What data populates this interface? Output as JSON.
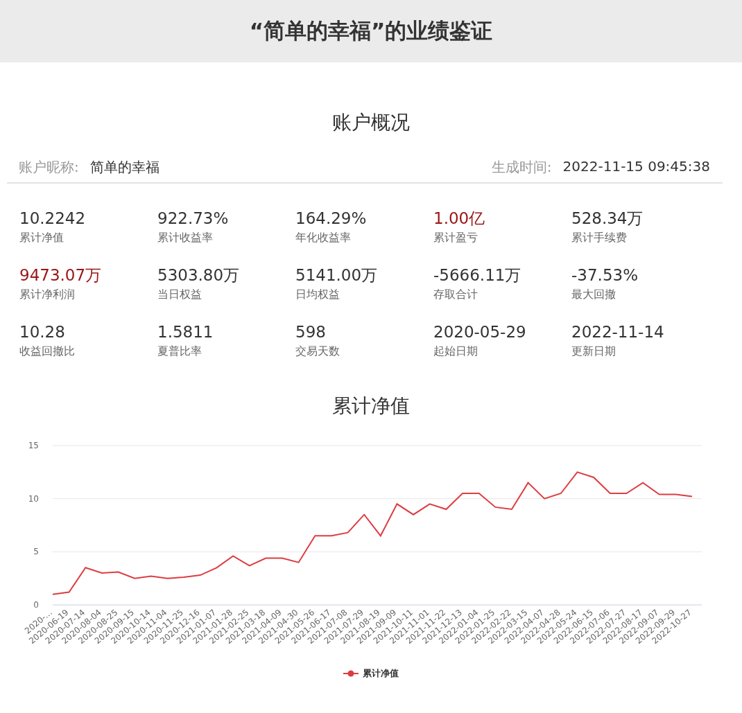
{
  "header": {
    "title": "“简单的幸福”的业绩鉴证"
  },
  "overview": {
    "heading": "账户概况",
    "nickname_label": "账户昵称:",
    "nickname": "简单的幸福",
    "generated_label": "生成时间:",
    "generated": "2022-11-15 09:45:38"
  },
  "stats": [
    {
      "value": "10.2242",
      "label": "累计净值",
      "highlight": false
    },
    {
      "value": "922.73%",
      "label": "累计收益率",
      "highlight": false
    },
    {
      "value": "164.29%",
      "label": "年化收益率",
      "highlight": false
    },
    {
      "value": "1.00亿",
      "label": "累计盈亏",
      "highlight": true
    },
    {
      "value": "528.34万",
      "label": "累计手续费",
      "highlight": false
    },
    {
      "value": "9473.07万",
      "label": "累计净利润",
      "highlight": true
    },
    {
      "value": "5303.80万",
      "label": "当日权益",
      "highlight": false
    },
    {
      "value": "5141.00万",
      "label": "日均权益",
      "highlight": false
    },
    {
      "value": "-5666.11万",
      "label": "存取合计",
      "highlight": false
    },
    {
      "value": "-37.53%",
      "label": "最大回撤",
      "highlight": false
    },
    {
      "value": "10.28",
      "label": "收益回撤比",
      "highlight": false
    },
    {
      "value": "1.5811",
      "label": "夏普比率",
      "highlight": false
    },
    {
      "value": "598",
      "label": "交易天数",
      "highlight": false
    },
    {
      "value": "2020-05-29",
      "label": "起始日期",
      "highlight": false
    },
    {
      "value": "2022-11-14",
      "label": "更新日期",
      "highlight": false
    }
  ],
  "nav_chart": {
    "heading": "累计净值",
    "chart_data": {
      "type": "line",
      "categories": [
        "2020-…",
        "2020-06-19",
        "2020-07-14",
        "2020-08-04",
        "2020-08-25",
        "2020-09-15",
        "2020-10-14",
        "2020-11-04",
        "2020-11-25",
        "2020-12-16",
        "2021-01-07",
        "2021-01-28",
        "2021-02-25",
        "2021-03-18",
        "2021-04-09",
        "2021-04-30",
        "2021-05-26",
        "2021-06-17",
        "2021-07-08",
        "2021-07-29",
        "2021-08-19",
        "2021-09-09",
        "2021-10-11",
        "2021-11-01",
        "2021-11-22",
        "2021-12-13",
        "2022-01-04",
        "2022-01-25",
        "2022-02-22",
        "2022-03-15",
        "2022-04-07",
        "2022-04-28",
        "2022-05-24",
        "2022-06-15",
        "2022-07-06",
        "2022-07-27",
        "2022-08-17",
        "2022-09-07",
        "2022-09-29",
        "2022-10-27"
      ],
      "series": [
        {
          "name": "累计净值",
          "color": "#dd3c41",
          "values": [
            1.0,
            1.2,
            3.5,
            3.0,
            3.1,
            2.5,
            2.7,
            2.5,
            2.6,
            2.8,
            3.5,
            4.6,
            3.7,
            4.4,
            4.4,
            4.0,
            6.5,
            6.5,
            6.8,
            8.5,
            6.5,
            9.5,
            8.5,
            9.5,
            9.0,
            10.5,
            10.5,
            9.2,
            9.0,
            11.5,
            10.0,
            10.5,
            12.5,
            12.0,
            10.5,
            10.5,
            11.5,
            10.4,
            10.4,
            10.2
          ]
        }
      ],
      "ylim": [
        0,
        15
      ],
      "yticks": [
        0,
        5,
        10,
        15
      ]
    }
  }
}
